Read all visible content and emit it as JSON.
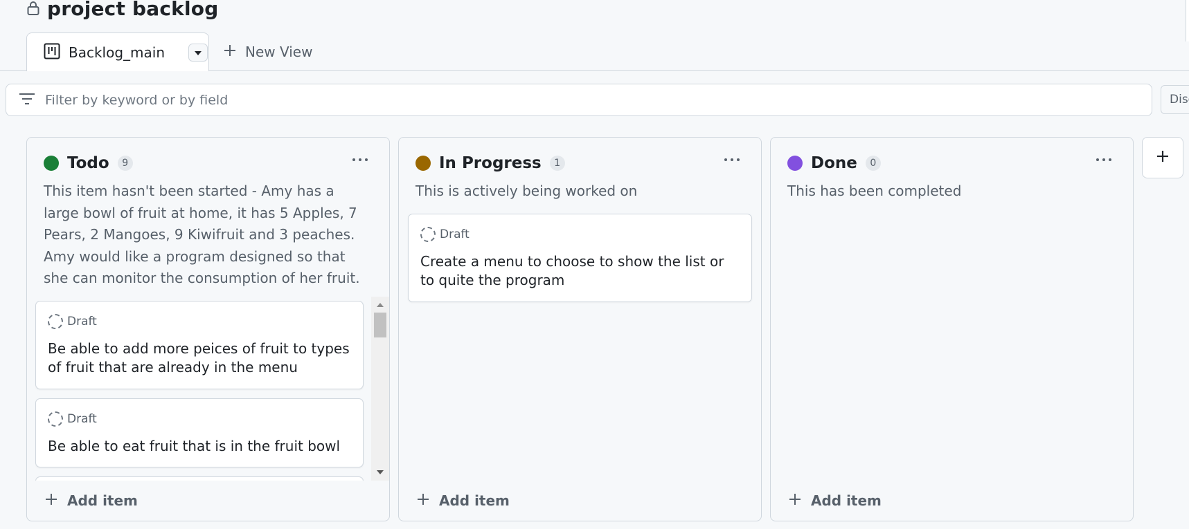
{
  "project": {
    "title": "project backlog"
  },
  "tabs": {
    "active_label": "Backlog_main",
    "new_view_label": "New View"
  },
  "filter": {
    "placeholder": "Filter by keyword or by field",
    "value": "",
    "discard_label": "Disc"
  },
  "columns": [
    {
      "name": "Todo",
      "count": "9",
      "color": "#1a7f37",
      "description": "This item hasn't been started - Amy has a large bowl of fruit at home, it has 5 Apples, 7 Pears, 2 Mangoes, 9 Kiwifruit and 3 peaches. Amy would like a program designed so that she can monitor the consumption of her fruit.",
      "cards": [
        {
          "status": "Draft",
          "text": "Be able to add more peices of fruit to types of fruit that are already in the menu"
        },
        {
          "status": "Draft",
          "text": "Be able to eat fruit that is in the fruit bowl"
        }
      ],
      "add_label": "Add item"
    },
    {
      "name": "In Progress",
      "count": "1",
      "color": "#9a6700",
      "description": "This is actively being worked on",
      "cards": [
        {
          "status": "Draft",
          "text": "Create a menu to choose to show the list or to quite the program"
        }
      ],
      "add_label": "Add item"
    },
    {
      "name": "Done",
      "count": "0",
      "color": "#8250df",
      "description": "This has been completed",
      "cards": [],
      "add_label": "Add item"
    }
  ],
  "icons": {
    "lock": "lock-icon",
    "board": "board-icon",
    "dropdown": "triangle-down-icon",
    "plus": "plus-icon",
    "filter": "filter-icon",
    "kebab": "kebab-horizontal-icon",
    "draft": "issue-draft-icon"
  }
}
